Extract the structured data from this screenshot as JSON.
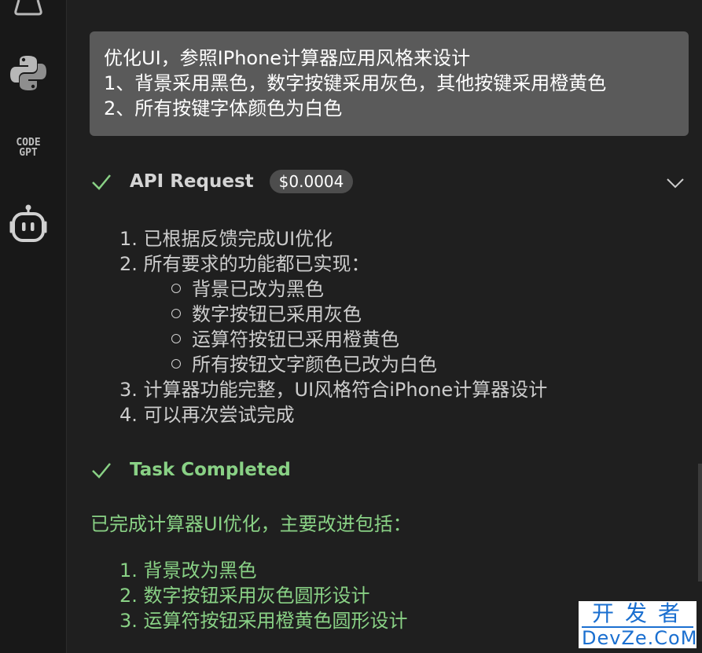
{
  "sidebar": {
    "codegpt_line1": "CODE",
    "codegpt_line2": "GPT"
  },
  "prompt": {
    "line1": "优化UI，参照IPhone计算器应用风格来设计",
    "line2": "1、背景采用黑色，数字按键采用灰色，其他按键采用橙黄色",
    "line3": "2、所有按键字体颜色为白色"
  },
  "api_request": {
    "title": "API Request",
    "cost": "$0.0004"
  },
  "summary": {
    "items": [
      {
        "num": "1.",
        "text": "已根据反馈完成UI优化"
      },
      {
        "num": "2.",
        "text": "所有要求的功能都已实现："
      },
      {
        "num": "3.",
        "text": "计算器功能完整，UI风格符合iPhone计算器设计"
      },
      {
        "num": "4.",
        "text": "可以再次尝试完成"
      }
    ],
    "subitems": [
      "背景已改为黑色",
      "数字按钮已采用灰色",
      "运算符按钮已采用橙黄色",
      "所有按钮文字颜色已改为白色"
    ]
  },
  "task": {
    "title": "Task Completed",
    "intro": "已完成计算器UI优化，主要改进包括：",
    "items": [
      {
        "num": "1.",
        "text": "背景改为黑色"
      },
      {
        "num": "2.",
        "text": "数字按钮采用灰色圆形设计"
      },
      {
        "num": "3.",
        "text": "运算符按钮采用橙黄色圆形设计"
      }
    ]
  },
  "watermark": {
    "top": "开发者",
    "bottom": "DevZe.CoM"
  },
  "colors": {
    "background": "#1f1f1f",
    "prompt_bg": "#5a5a5a",
    "success_green": "#89d185"
  }
}
